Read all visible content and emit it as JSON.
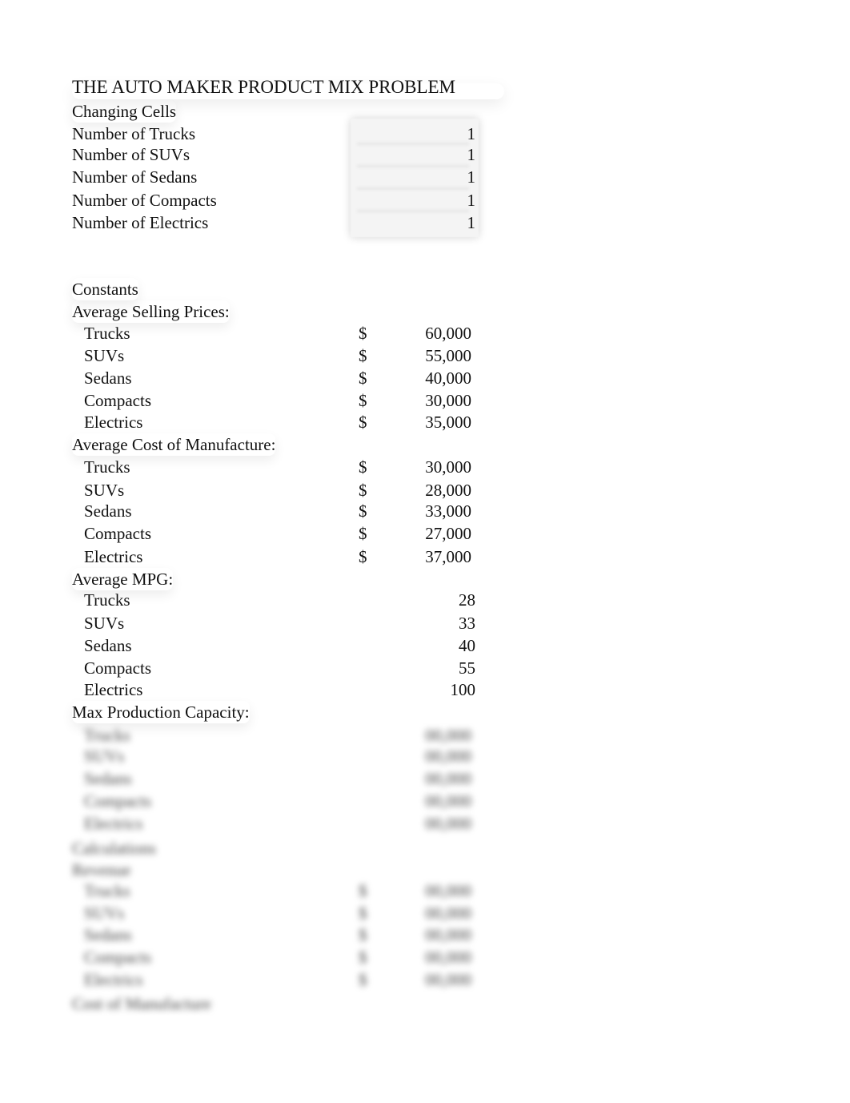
{
  "title": "THE AUTO MAKER PRODUCT MIX PROBLEM",
  "changing_cells": {
    "heading": "Changing Cells",
    "rows": [
      {
        "label": "Number of Trucks",
        "value": "1"
      },
      {
        "label": "Number of SUVs",
        "value": "1"
      },
      {
        "label": "Number of Sedans",
        "value": "1"
      },
      {
        "label": "Number of Compacts",
        "value": "1"
      },
      {
        "label": "Number of Electrics",
        "value": "1"
      }
    ]
  },
  "constants": {
    "heading": "Constants",
    "selling_prices": {
      "heading": "Average Selling Prices:",
      "currency": "$",
      "rows": [
        {
          "label": "Trucks",
          "value": "60,000"
        },
        {
          "label": "SUVs",
          "value": "55,000"
        },
        {
          "label": "Sedans",
          "value": "40,000"
        },
        {
          "label": "Compacts",
          "value": "30,000"
        },
        {
          "label": "Electrics",
          "value": "35,000"
        }
      ]
    },
    "cost_of_manufacture": {
      "heading": "Average Cost of Manufacture:",
      "currency": "$",
      "rows": [
        {
          "label": "Trucks",
          "value": "30,000"
        },
        {
          "label": "SUVs",
          "value": "28,000"
        },
        {
          "label": "Sedans",
          "value": "33,000"
        },
        {
          "label": "Compacts",
          "value": "27,000"
        },
        {
          "label": "Electrics",
          "value": "37,000"
        }
      ]
    },
    "mpg": {
      "heading": "Average MPG:",
      "rows": [
        {
          "label": "Trucks",
          "value": "28"
        },
        {
          "label": "SUVs",
          "value": "33"
        },
        {
          "label": "Sedans",
          "value": "40"
        },
        {
          "label": "Compacts",
          "value": "55"
        },
        {
          "label": "Electrics",
          "value": "100"
        }
      ]
    },
    "max_capacity": {
      "heading": "Max Production Capacity:",
      "rows": [
        {
          "label": "Trucks",
          "value": "00,000"
        },
        {
          "label": "SUVs",
          "value": "00,000"
        },
        {
          "label": "Sedans",
          "value": "00,000"
        },
        {
          "label": "Compacts",
          "value": "00,000"
        },
        {
          "label": "Electrics",
          "value": "00,000"
        }
      ]
    }
  },
  "calculations": {
    "heading": "Calculations",
    "revenue": {
      "heading": "Revenue",
      "currency": "$",
      "rows": [
        {
          "label": "Trucks",
          "value": "00,000"
        },
        {
          "label": "SUVs",
          "value": "00,000"
        },
        {
          "label": "Sedans",
          "value": "00,000"
        },
        {
          "label": "Compacts",
          "value": "00,000"
        },
        {
          "label": "Electrics",
          "value": "00,000"
        }
      ]
    },
    "cost_heading": "Cost of Manufacture"
  }
}
